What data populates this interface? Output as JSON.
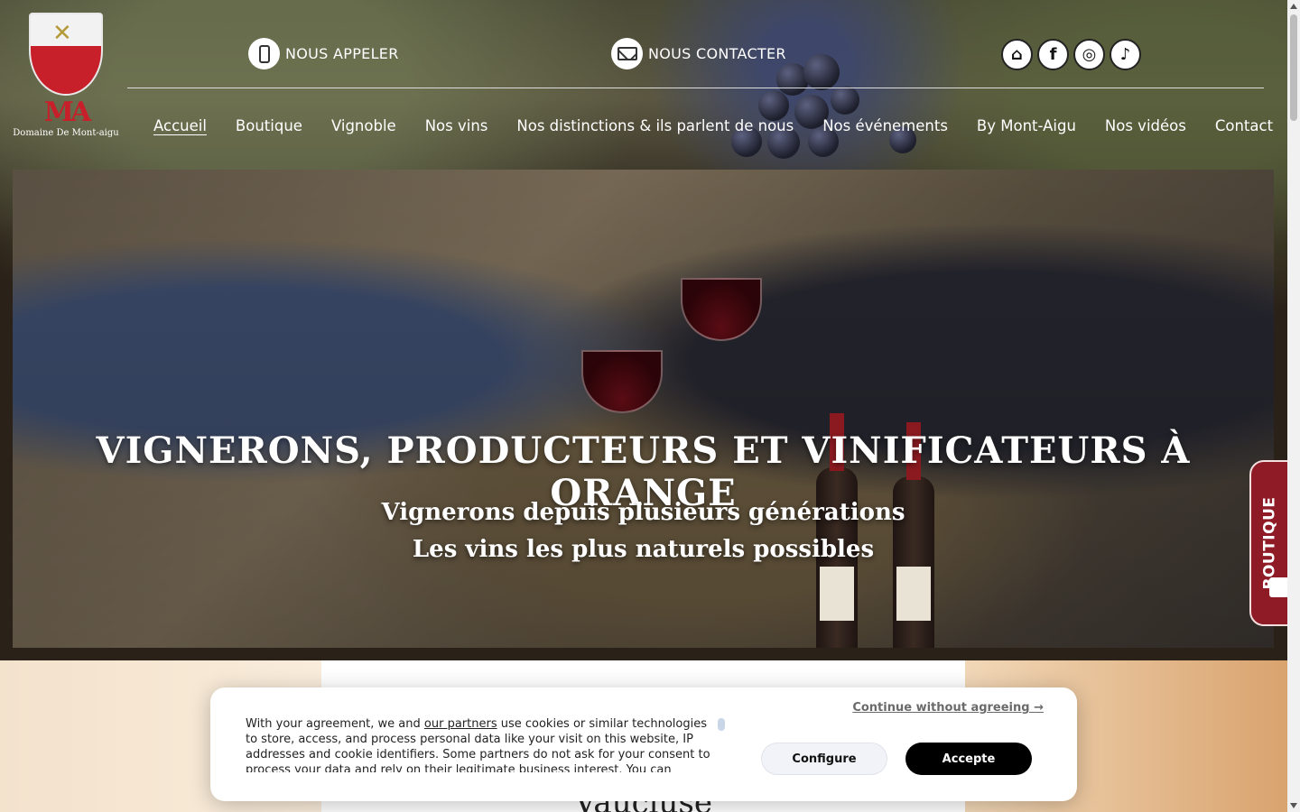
{
  "header": {
    "logo_name": "Domaine De Mont-aigu",
    "logo_monogram": "MA",
    "call_label": "NOUS APPELER",
    "contact_label": "NOUS CONTACTER",
    "socials": [
      {
        "name": "store-icon",
        "glyph": "⌂"
      },
      {
        "name": "facebook-icon",
        "glyph": "f"
      },
      {
        "name": "instagram-icon",
        "glyph": "◎"
      },
      {
        "name": "tiktok-icon",
        "glyph": "♪"
      }
    ]
  },
  "nav": {
    "items": [
      {
        "label": "Accueil",
        "active": true
      },
      {
        "label": "Boutique"
      },
      {
        "label": "Vignoble"
      },
      {
        "label": "Nos vins"
      },
      {
        "label": "Nos distinctions & ils parlent de nous"
      },
      {
        "label": "Nos événements"
      },
      {
        "label": "By Mont-Aigu"
      },
      {
        "label": "Nos vidéos"
      },
      {
        "label": "Contact"
      }
    ]
  },
  "hero": {
    "title": "VIGNERONS, PRODUCTEURS ET VINIFICATEURS À ORANGE",
    "subtitle_line1": "Vignerons depuis plusieurs générations",
    "subtitle_line2": "Les vins les plus naturels possibles"
  },
  "side_tab": {
    "label": "BOUTIQUE"
  },
  "content": {
    "card_title": "Vaucluse"
  },
  "cookie": {
    "text_before_link": "With your agreement, we and ",
    "link_label": "our partners",
    "text_after_link": " use cookies or similar technologies to store, access, and process personal data like your visit on this website, IP addresses and cookie identifiers. Some partners do not ask for your consent to process your data and rely on their legitimate business interest. You can",
    "continue_label": "Continue without agreeing →",
    "configure_label": "Configure",
    "accept_label": "Accepte"
  },
  "colors": {
    "brand_red": "#8e1b25",
    "accent_black": "#000000"
  }
}
